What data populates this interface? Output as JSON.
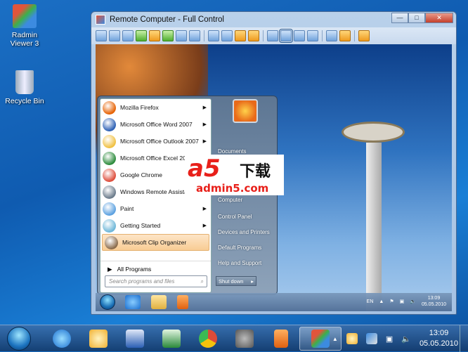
{
  "desktop": {
    "icons": [
      {
        "label": "Radmin Viewer 3",
        "icon": "radmin-icon"
      },
      {
        "label": "Recycle Bin",
        "icon": "recycle-bin-icon"
      }
    ]
  },
  "window": {
    "title": "Remote Computer - Full Control",
    "buttons": {
      "minimize": "—",
      "maximize": "□",
      "close": "✕"
    }
  },
  "toolbar": {
    "icons": [
      "full-control",
      "view-only",
      "telnet",
      "file-transfer",
      "shutdown",
      "chat",
      "voice-chat",
      "text-message",
      "send-text",
      "connections",
      "clipboard-get",
      "clipboard-send",
      "normal-mode",
      "stretch-mode",
      "full-screen",
      "full-screen-stretch",
      "screenshot",
      "settings",
      "close"
    ]
  },
  "start_menu": {
    "programs": [
      {
        "label": "Mozilla Firefox",
        "submenu": true,
        "color": "#e66000"
      },
      {
        "label": "Microsoft Office Word 2007",
        "submenu": true,
        "color": "#2b5fb4"
      },
      {
        "label": "Microsoft Office Outlook 2007",
        "submenu": true,
        "color": "#f0c040"
      },
      {
        "label": "Microsoft Office Excel 2007",
        "submenu": false,
        "color": "#2a8a3a"
      },
      {
        "label": "Google Chrome",
        "submenu": false,
        "color": "#dd4b39"
      },
      {
        "label": "Windows Remote Assistance",
        "submenu": false,
        "color": "#6a7a8a"
      },
      {
        "label": "Paint",
        "submenu": true,
        "color": "#5aa0e0"
      },
      {
        "label": "Getting Started",
        "submenu": true,
        "color": "#6cb6d8"
      },
      {
        "label": "Microsoft Clip Organizer",
        "submenu": false,
        "color": "#8a6a4a"
      }
    ],
    "all_programs": "All Programs",
    "search_placeholder": "Search programs and files",
    "right_items": [
      "Documents",
      "Computer",
      "Control Panel",
      "Devices and Printers",
      "Default Programs",
      "Help and Support"
    ],
    "shutdown": "Shut down"
  },
  "remote_taskbar": {
    "language": "EN",
    "time": "13:09",
    "date": "05.05.2010"
  },
  "taskbar": {
    "time": "13:09",
    "date": "05.05.2010"
  },
  "watermark": {
    "logo": "a5",
    "chinese": "下载",
    "domain": "admin5.com"
  }
}
